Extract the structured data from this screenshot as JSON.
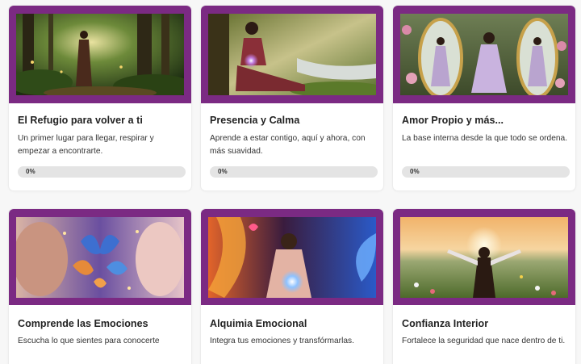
{
  "colors": {
    "accent": "#7b2a83",
    "page_background": "#f7f7f7",
    "card_background": "#ffffff",
    "progress_track": "#e4e4e4"
  },
  "courses": [
    {
      "title": "El Refugio para volver a ti",
      "description": "Un primer lugar para llegar, respirar y empezar a encontrarte.",
      "progress_label": "0%",
      "progress": 0
    },
    {
      "title": "Presencia y Calma",
      "description": "Aprende a estar contigo, aquí y ahora, con más suavidad.",
      "progress_label": "0%",
      "progress": 0
    },
    {
      "title": "Amor Propio y más...",
      "description": "La base interna desde la que todo se ordena.",
      "progress_label": "0%",
      "progress": 0
    },
    {
      "title": "Comprende las Emociones",
      "description": "Escucha lo que sientes para conocerte"
    },
    {
      "title": "Alquimia Emocional",
      "description": "Integra tus emociones y transfórmarlas."
    },
    {
      "title": "Confianza Interior",
      "description": "Fortalece la seguridad que nace dentro de ti."
    }
  ]
}
